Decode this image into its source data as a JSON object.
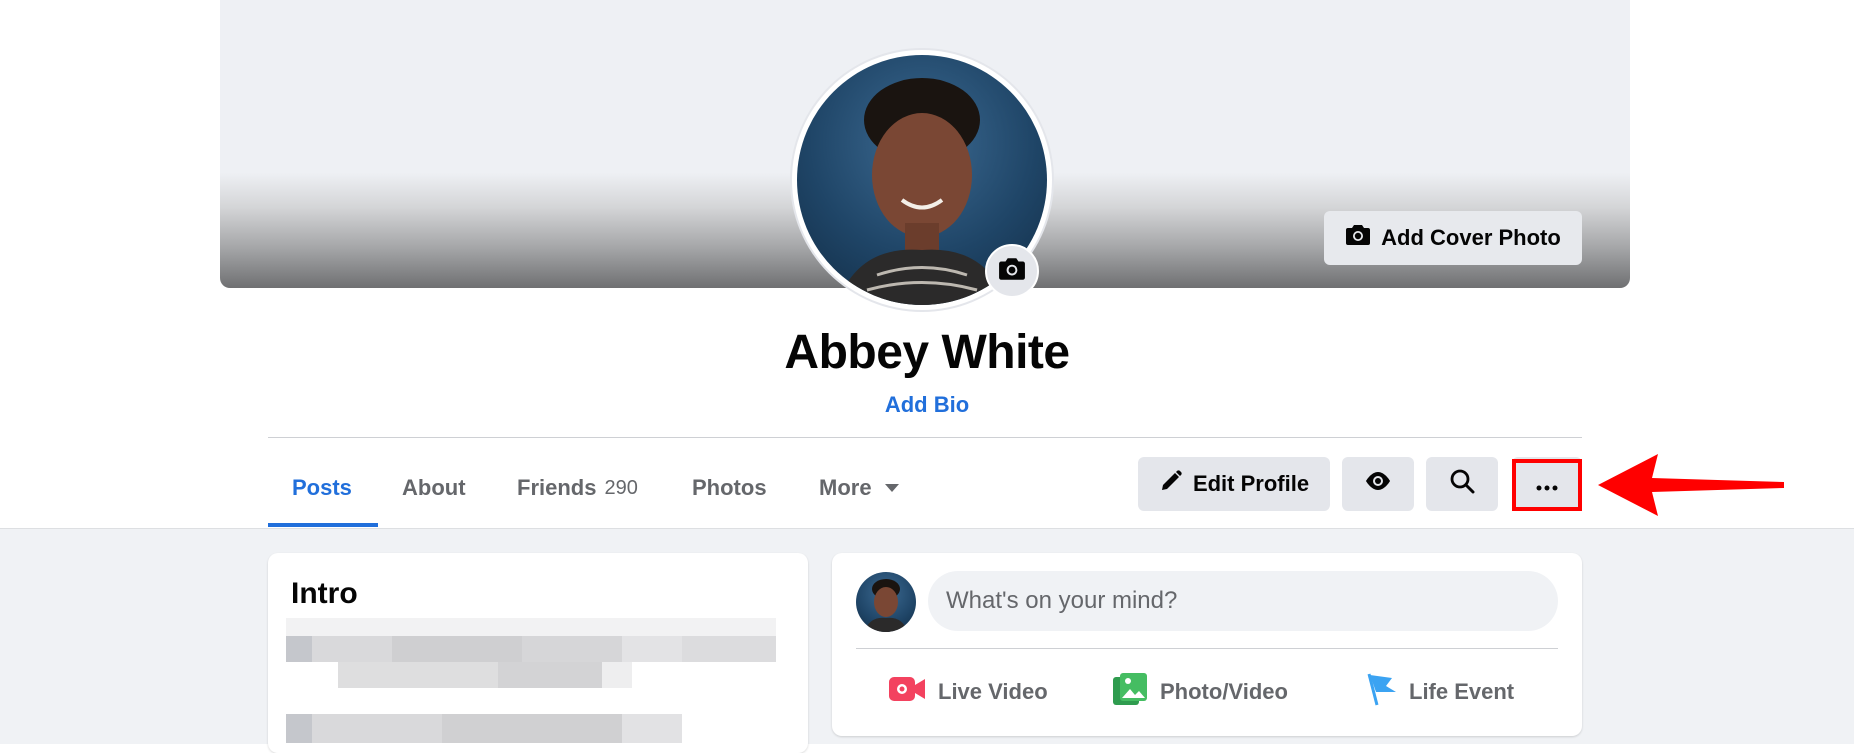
{
  "profile": {
    "name": "Abbey White",
    "add_bio_label": "Add Bio",
    "add_cover_photo_label": "Add Cover Photo"
  },
  "tabs": [
    {
      "label": "Posts",
      "active": true
    },
    {
      "label": "About"
    },
    {
      "label": "Friends",
      "count": "290"
    },
    {
      "label": "Photos"
    },
    {
      "label": "More"
    }
  ],
  "actions": {
    "edit_profile_label": "Edit Profile",
    "view_as_icon": "eye-icon",
    "search_icon": "search-icon",
    "more_options_icon": "ellipsis-icon"
  },
  "intro": {
    "title": "Intro"
  },
  "composer": {
    "placeholder": "What's on your mind?",
    "actions": [
      {
        "label": "Live Video",
        "icon": "live-video-icon",
        "color": "#f3425f"
      },
      {
        "label": "Photo/Video",
        "icon": "photo-video-icon",
        "color": "#45bd62"
      },
      {
        "label": "Life Event",
        "icon": "life-event-icon",
        "color": "#3ba3f2"
      }
    ]
  },
  "colors": {
    "accent": "#216fdb",
    "highlight": "#ff0000"
  }
}
